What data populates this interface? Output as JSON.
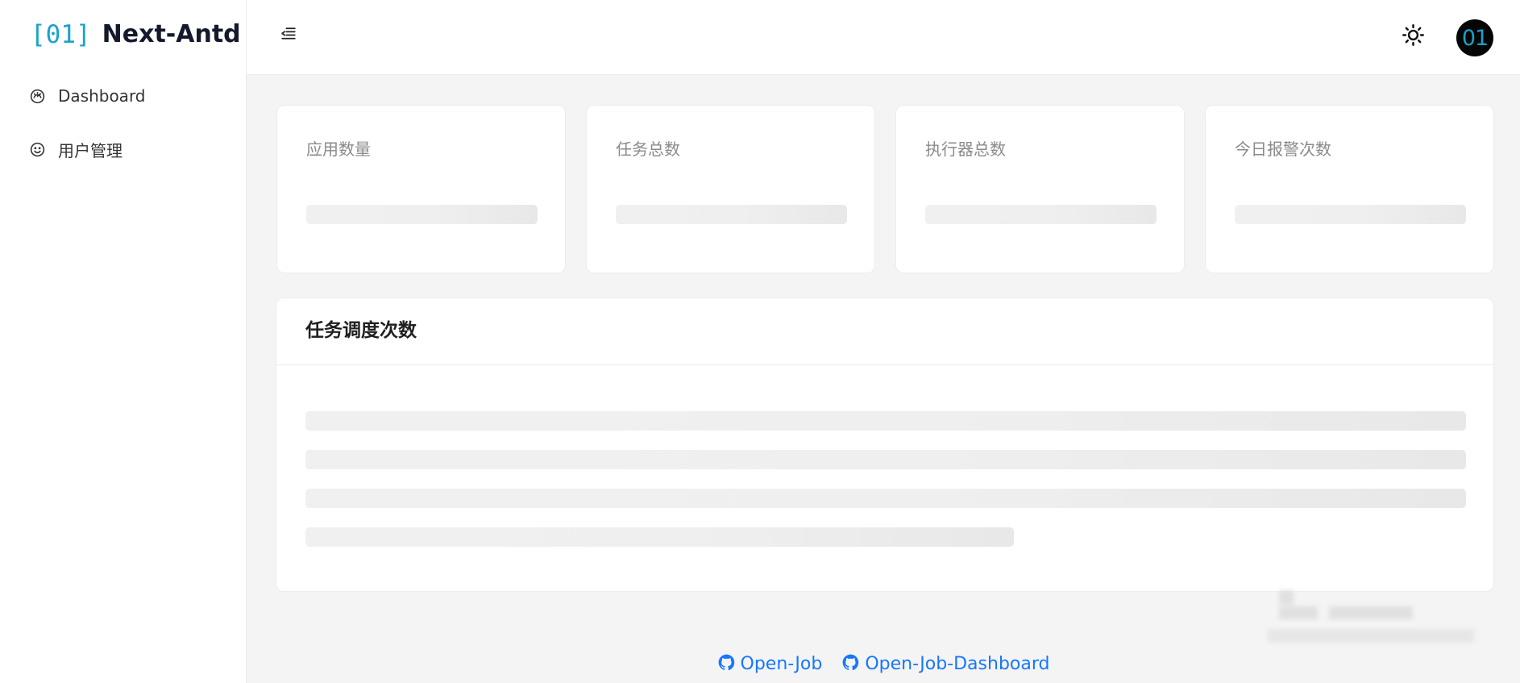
{
  "brand": {
    "mark": "[01]",
    "name": "Next-Antd",
    "color": "#1aa3c8"
  },
  "sidebar": {
    "items": [
      {
        "label": "Dashboard",
        "icon": "dashboard-icon"
      },
      {
        "label": "用户管理",
        "icon": "smile-icon"
      }
    ]
  },
  "header": {
    "collapse_icon": "menu-fold-icon",
    "theme_icon": "sun-icon",
    "avatar_text": "01"
  },
  "dashboard": {
    "stats": [
      {
        "title": "应用数量"
      },
      {
        "title": "任务总数"
      },
      {
        "title": "执行器总数"
      },
      {
        "title": "今日报警次数"
      }
    ],
    "schedule_card": {
      "title": "任务调度次数",
      "skeleton_lines": 4
    }
  },
  "footer": {
    "links": [
      {
        "label": "Open-Job",
        "icon": "github-icon"
      },
      {
        "label": "Open-Job-Dashboard",
        "icon": "github-icon"
      }
    ],
    "link_color": "#1677ff"
  }
}
